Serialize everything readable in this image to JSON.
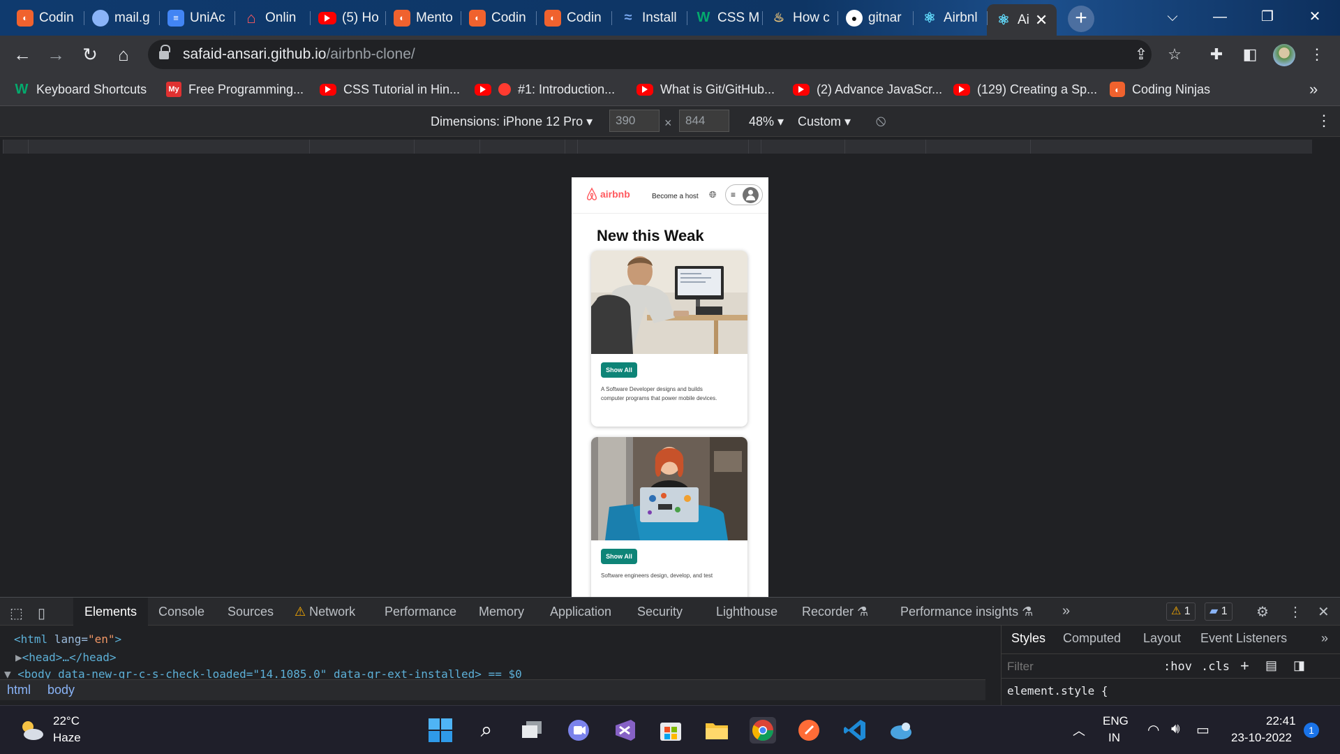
{
  "browser": {
    "tabs": [
      {
        "title": "Codin",
        "icon": "coding-ninjas-icon"
      },
      {
        "title": "mail.g",
        "icon": "globe-icon"
      },
      {
        "title": "UniAc",
        "icon": "document-icon"
      },
      {
        "title": "Onlin",
        "icon": "airbnb-icon"
      },
      {
        "title": "(5) Ho",
        "icon": "youtube-icon"
      },
      {
        "title": "Mento",
        "icon": "coding-ninjas-icon"
      },
      {
        "title": "Codin",
        "icon": "coding-ninjas-icon"
      },
      {
        "title": "Codin",
        "icon": "coding-ninjas-icon"
      },
      {
        "title": "Install",
        "icon": "wave-icon"
      },
      {
        "title": "CSS M",
        "icon": "w3schools-icon"
      },
      {
        "title": "How c",
        "icon": "howto-icon"
      },
      {
        "title": "gitnar",
        "icon": "github-icon"
      },
      {
        "title": "Airbnl",
        "icon": "react-icon"
      },
      {
        "title": "Ai",
        "icon": "react-icon",
        "active": true
      }
    ],
    "url_host": "safaid-ansari.github.io",
    "url_path": "/airbnb-clone/",
    "bookmarks": [
      {
        "label": "Keyboard Shortcuts",
        "icon": "w3schools-icon"
      },
      {
        "label": "Free Programming...",
        "icon": "my-icon"
      },
      {
        "label": "CSS Tutorial in Hin...",
        "icon": "youtube-icon"
      },
      {
        "label": "#1: Introduction...",
        "icon": "record-icon"
      },
      {
        "label": "What is Git/GitHub...",
        "icon": "youtube-icon"
      },
      {
        "label": "(2) Advance JavaScr...",
        "icon": "youtube-icon"
      },
      {
        "label": "(129) Creating a Sp...",
        "icon": "youtube-icon"
      },
      {
        "label": "Coding Ninjas",
        "icon": "coding-ninjas-icon"
      }
    ],
    "overflow_label": "»"
  },
  "device_toolbar": {
    "dimensions_label": "Dimensions: iPhone 12 Pro",
    "width": "390",
    "height": "844",
    "times": "×",
    "zoom": "48%",
    "throttle": "Custom"
  },
  "page": {
    "logo_text": "airbnb",
    "become_host": "Become a host",
    "section_title": "New this Weak",
    "cards": [
      {
        "button": "Show All",
        "description": "A Software Developer designs and builds computer programs that power mobile devices."
      },
      {
        "button": "Show All",
        "description": "Software engineers design, develop, and test"
      }
    ]
  },
  "devtools": {
    "tabs": [
      "Elements",
      "Console",
      "Sources",
      "Network",
      "Performance",
      "Memory",
      "Application",
      "Security",
      "Lighthouse",
      "Recorder",
      "Performance insights"
    ],
    "warnings": "1",
    "messages": "1",
    "code": {
      "line1_open": "<html",
      "line1_attr": " lang=",
      "line1_val": "\"en\"",
      "line1_close": ">",
      "line2": "<head>…</head>",
      "line3": "<body data-new-gr-c-s-check-loaded=\"14.1085.0\" data-gr-ext-installed> == $0"
    },
    "breadcrumb": [
      "html",
      "body"
    ],
    "styles_tabs": [
      "Styles",
      "Computed",
      "Layout",
      "Event Listeners"
    ],
    "filter_placeholder": "Filter",
    "hov": ":hov",
    "cls": ".cls",
    "element_style": "element.style {"
  },
  "taskbar": {
    "weather_temp": "22°C",
    "weather_desc": "Haze",
    "lang": "ENG",
    "region": "IN",
    "time": "22:41",
    "date": "23-10-2022",
    "notification_count": "1"
  }
}
